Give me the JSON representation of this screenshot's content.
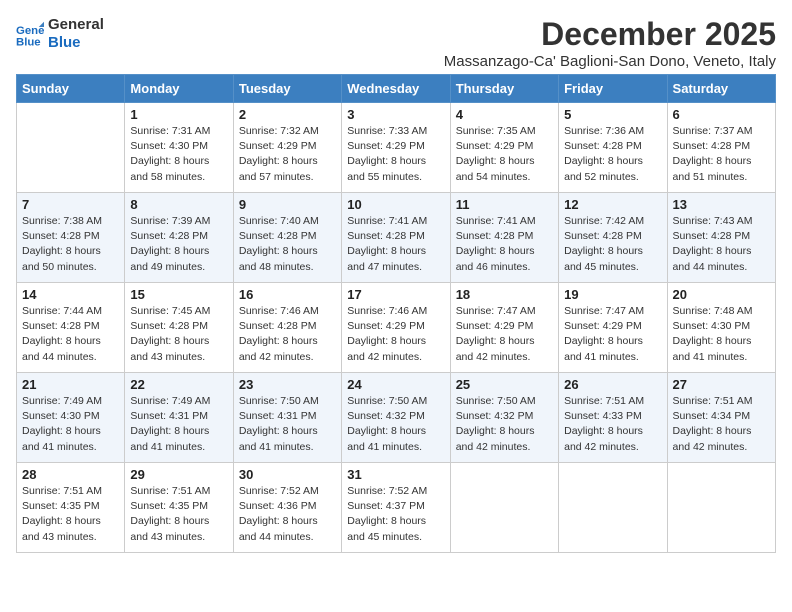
{
  "header": {
    "logo_line1": "General",
    "logo_line2": "Blue",
    "title": "December 2025",
    "subtitle": "Massanzago-Ca' Baglioni-San Dono, Veneto, Italy"
  },
  "days_of_week": [
    "Sunday",
    "Monday",
    "Tuesday",
    "Wednesday",
    "Thursday",
    "Friday",
    "Saturday"
  ],
  "weeks": [
    [
      {
        "day": "",
        "info": ""
      },
      {
        "day": "1",
        "info": "Sunrise: 7:31 AM\nSunset: 4:30 PM\nDaylight: 8 hours\nand 58 minutes."
      },
      {
        "day": "2",
        "info": "Sunrise: 7:32 AM\nSunset: 4:29 PM\nDaylight: 8 hours\nand 57 minutes."
      },
      {
        "day": "3",
        "info": "Sunrise: 7:33 AM\nSunset: 4:29 PM\nDaylight: 8 hours\nand 55 minutes."
      },
      {
        "day": "4",
        "info": "Sunrise: 7:35 AM\nSunset: 4:29 PM\nDaylight: 8 hours\nand 54 minutes."
      },
      {
        "day": "5",
        "info": "Sunrise: 7:36 AM\nSunset: 4:28 PM\nDaylight: 8 hours\nand 52 minutes."
      },
      {
        "day": "6",
        "info": "Sunrise: 7:37 AM\nSunset: 4:28 PM\nDaylight: 8 hours\nand 51 minutes."
      }
    ],
    [
      {
        "day": "7",
        "info": "Sunrise: 7:38 AM\nSunset: 4:28 PM\nDaylight: 8 hours\nand 50 minutes."
      },
      {
        "day": "8",
        "info": "Sunrise: 7:39 AM\nSunset: 4:28 PM\nDaylight: 8 hours\nand 49 minutes."
      },
      {
        "day": "9",
        "info": "Sunrise: 7:40 AM\nSunset: 4:28 PM\nDaylight: 8 hours\nand 48 minutes."
      },
      {
        "day": "10",
        "info": "Sunrise: 7:41 AM\nSunset: 4:28 PM\nDaylight: 8 hours\nand 47 minutes."
      },
      {
        "day": "11",
        "info": "Sunrise: 7:41 AM\nSunset: 4:28 PM\nDaylight: 8 hours\nand 46 minutes."
      },
      {
        "day": "12",
        "info": "Sunrise: 7:42 AM\nSunset: 4:28 PM\nDaylight: 8 hours\nand 45 minutes."
      },
      {
        "day": "13",
        "info": "Sunrise: 7:43 AM\nSunset: 4:28 PM\nDaylight: 8 hours\nand 44 minutes."
      }
    ],
    [
      {
        "day": "14",
        "info": "Sunrise: 7:44 AM\nSunset: 4:28 PM\nDaylight: 8 hours\nand 44 minutes."
      },
      {
        "day": "15",
        "info": "Sunrise: 7:45 AM\nSunset: 4:28 PM\nDaylight: 8 hours\nand 43 minutes."
      },
      {
        "day": "16",
        "info": "Sunrise: 7:46 AM\nSunset: 4:28 PM\nDaylight: 8 hours\nand 42 minutes."
      },
      {
        "day": "17",
        "info": "Sunrise: 7:46 AM\nSunset: 4:29 PM\nDaylight: 8 hours\nand 42 minutes."
      },
      {
        "day": "18",
        "info": "Sunrise: 7:47 AM\nSunset: 4:29 PM\nDaylight: 8 hours\nand 42 minutes."
      },
      {
        "day": "19",
        "info": "Sunrise: 7:47 AM\nSunset: 4:29 PM\nDaylight: 8 hours\nand 41 minutes."
      },
      {
        "day": "20",
        "info": "Sunrise: 7:48 AM\nSunset: 4:30 PM\nDaylight: 8 hours\nand 41 minutes."
      }
    ],
    [
      {
        "day": "21",
        "info": "Sunrise: 7:49 AM\nSunset: 4:30 PM\nDaylight: 8 hours\nand 41 minutes."
      },
      {
        "day": "22",
        "info": "Sunrise: 7:49 AM\nSunset: 4:31 PM\nDaylight: 8 hours\nand 41 minutes."
      },
      {
        "day": "23",
        "info": "Sunrise: 7:50 AM\nSunset: 4:31 PM\nDaylight: 8 hours\nand 41 minutes."
      },
      {
        "day": "24",
        "info": "Sunrise: 7:50 AM\nSunset: 4:32 PM\nDaylight: 8 hours\nand 41 minutes."
      },
      {
        "day": "25",
        "info": "Sunrise: 7:50 AM\nSunset: 4:32 PM\nDaylight: 8 hours\nand 42 minutes."
      },
      {
        "day": "26",
        "info": "Sunrise: 7:51 AM\nSunset: 4:33 PM\nDaylight: 8 hours\nand 42 minutes."
      },
      {
        "day": "27",
        "info": "Sunrise: 7:51 AM\nSunset: 4:34 PM\nDaylight: 8 hours\nand 42 minutes."
      }
    ],
    [
      {
        "day": "28",
        "info": "Sunrise: 7:51 AM\nSunset: 4:35 PM\nDaylight: 8 hours\nand 43 minutes."
      },
      {
        "day": "29",
        "info": "Sunrise: 7:51 AM\nSunset: 4:35 PM\nDaylight: 8 hours\nand 43 minutes."
      },
      {
        "day": "30",
        "info": "Sunrise: 7:52 AM\nSunset: 4:36 PM\nDaylight: 8 hours\nand 44 minutes."
      },
      {
        "day": "31",
        "info": "Sunrise: 7:52 AM\nSunset: 4:37 PM\nDaylight: 8 hours\nand 45 minutes."
      },
      {
        "day": "",
        "info": ""
      },
      {
        "day": "",
        "info": ""
      },
      {
        "day": "",
        "info": ""
      }
    ]
  ]
}
